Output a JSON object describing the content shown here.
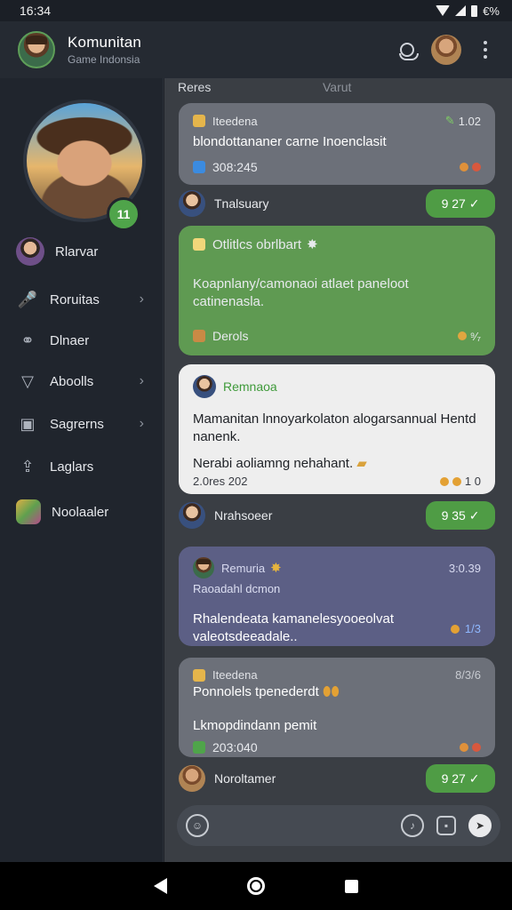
{
  "status_bar": {
    "time": "16:34",
    "battery_text": "€%"
  },
  "header": {
    "title": "Komunitan",
    "subtitle": "Game Indonsia"
  },
  "sidebar": {
    "profile_badge": "11",
    "items": [
      {
        "label": "Rlarvar",
        "icon": "user-avatar"
      },
      {
        "label": "Roruitas",
        "icon": "microphone-icon",
        "chevron": "›"
      },
      {
        "label": "Dlnaer",
        "icon": "link-icon"
      },
      {
        "label": "Aboolls",
        "icon": "filter-icon",
        "chevron": "›"
      },
      {
        "label": "Sagrerns",
        "icon": "screen-icon",
        "chevron": "›"
      },
      {
        "label": "Laglars",
        "icon": "upload-icon"
      },
      {
        "label": "Noolaaler",
        "icon": "game-icon"
      }
    ]
  },
  "chat": {
    "col_left": "Reres",
    "col_right": "Varut",
    "messages": [
      {
        "type": "card",
        "style": "grey",
        "author": "Iteedena",
        "time": "1.02",
        "text": "blondottananer carne Inoenclasit",
        "footer_text": "308:245"
      },
      {
        "type": "sender",
        "name": "Tnalsuary",
        "pill": "9 27 ✓"
      },
      {
        "type": "card",
        "style": "green",
        "author": "Otlitlcs obrlbart",
        "text": "Koapnlany/camonaoi atlaet paneloot catinenasla.",
        "footer_text": "Derols",
        "footer_right": "⁹⁄₇"
      },
      {
        "type": "card",
        "style": "white",
        "author": "Remnaoa",
        "text": "Mamanitan lnnoyarkolaton alogarsannual Hentd nanenk.",
        "text2": "Nerabi aoliamng nehahant.",
        "time": "2.0res 202",
        "footer_right": "1 0"
      },
      {
        "type": "sender",
        "name": "Nrahsoeer",
        "pill": "9 35 ✓"
      },
      {
        "type": "card",
        "style": "indigo",
        "author": "Remuria",
        "time": "3:0.39",
        "subtitle": "Raoadahl dcmon",
        "text": "Rhalendeata kamanelesyooeolvat valeotsdeeadale..",
        "footer_right": "1/3"
      },
      {
        "type": "card",
        "style": "grey",
        "author": "Iteedena",
        "time": "8/3/6",
        "subtitle": "Ponnolels tpenederdt",
        "text": "Lkmopdindann pemit",
        "footer_text": "203:040"
      },
      {
        "type": "sender",
        "name": "Noroltamer",
        "pill": "9 27 ✓"
      }
    ]
  },
  "composer": {
    "placeholder": ""
  },
  "colors": {
    "accent_green": "#4f9c45",
    "sidebar_bg": "#20252d",
    "main_bg": "#3a3e44"
  }
}
